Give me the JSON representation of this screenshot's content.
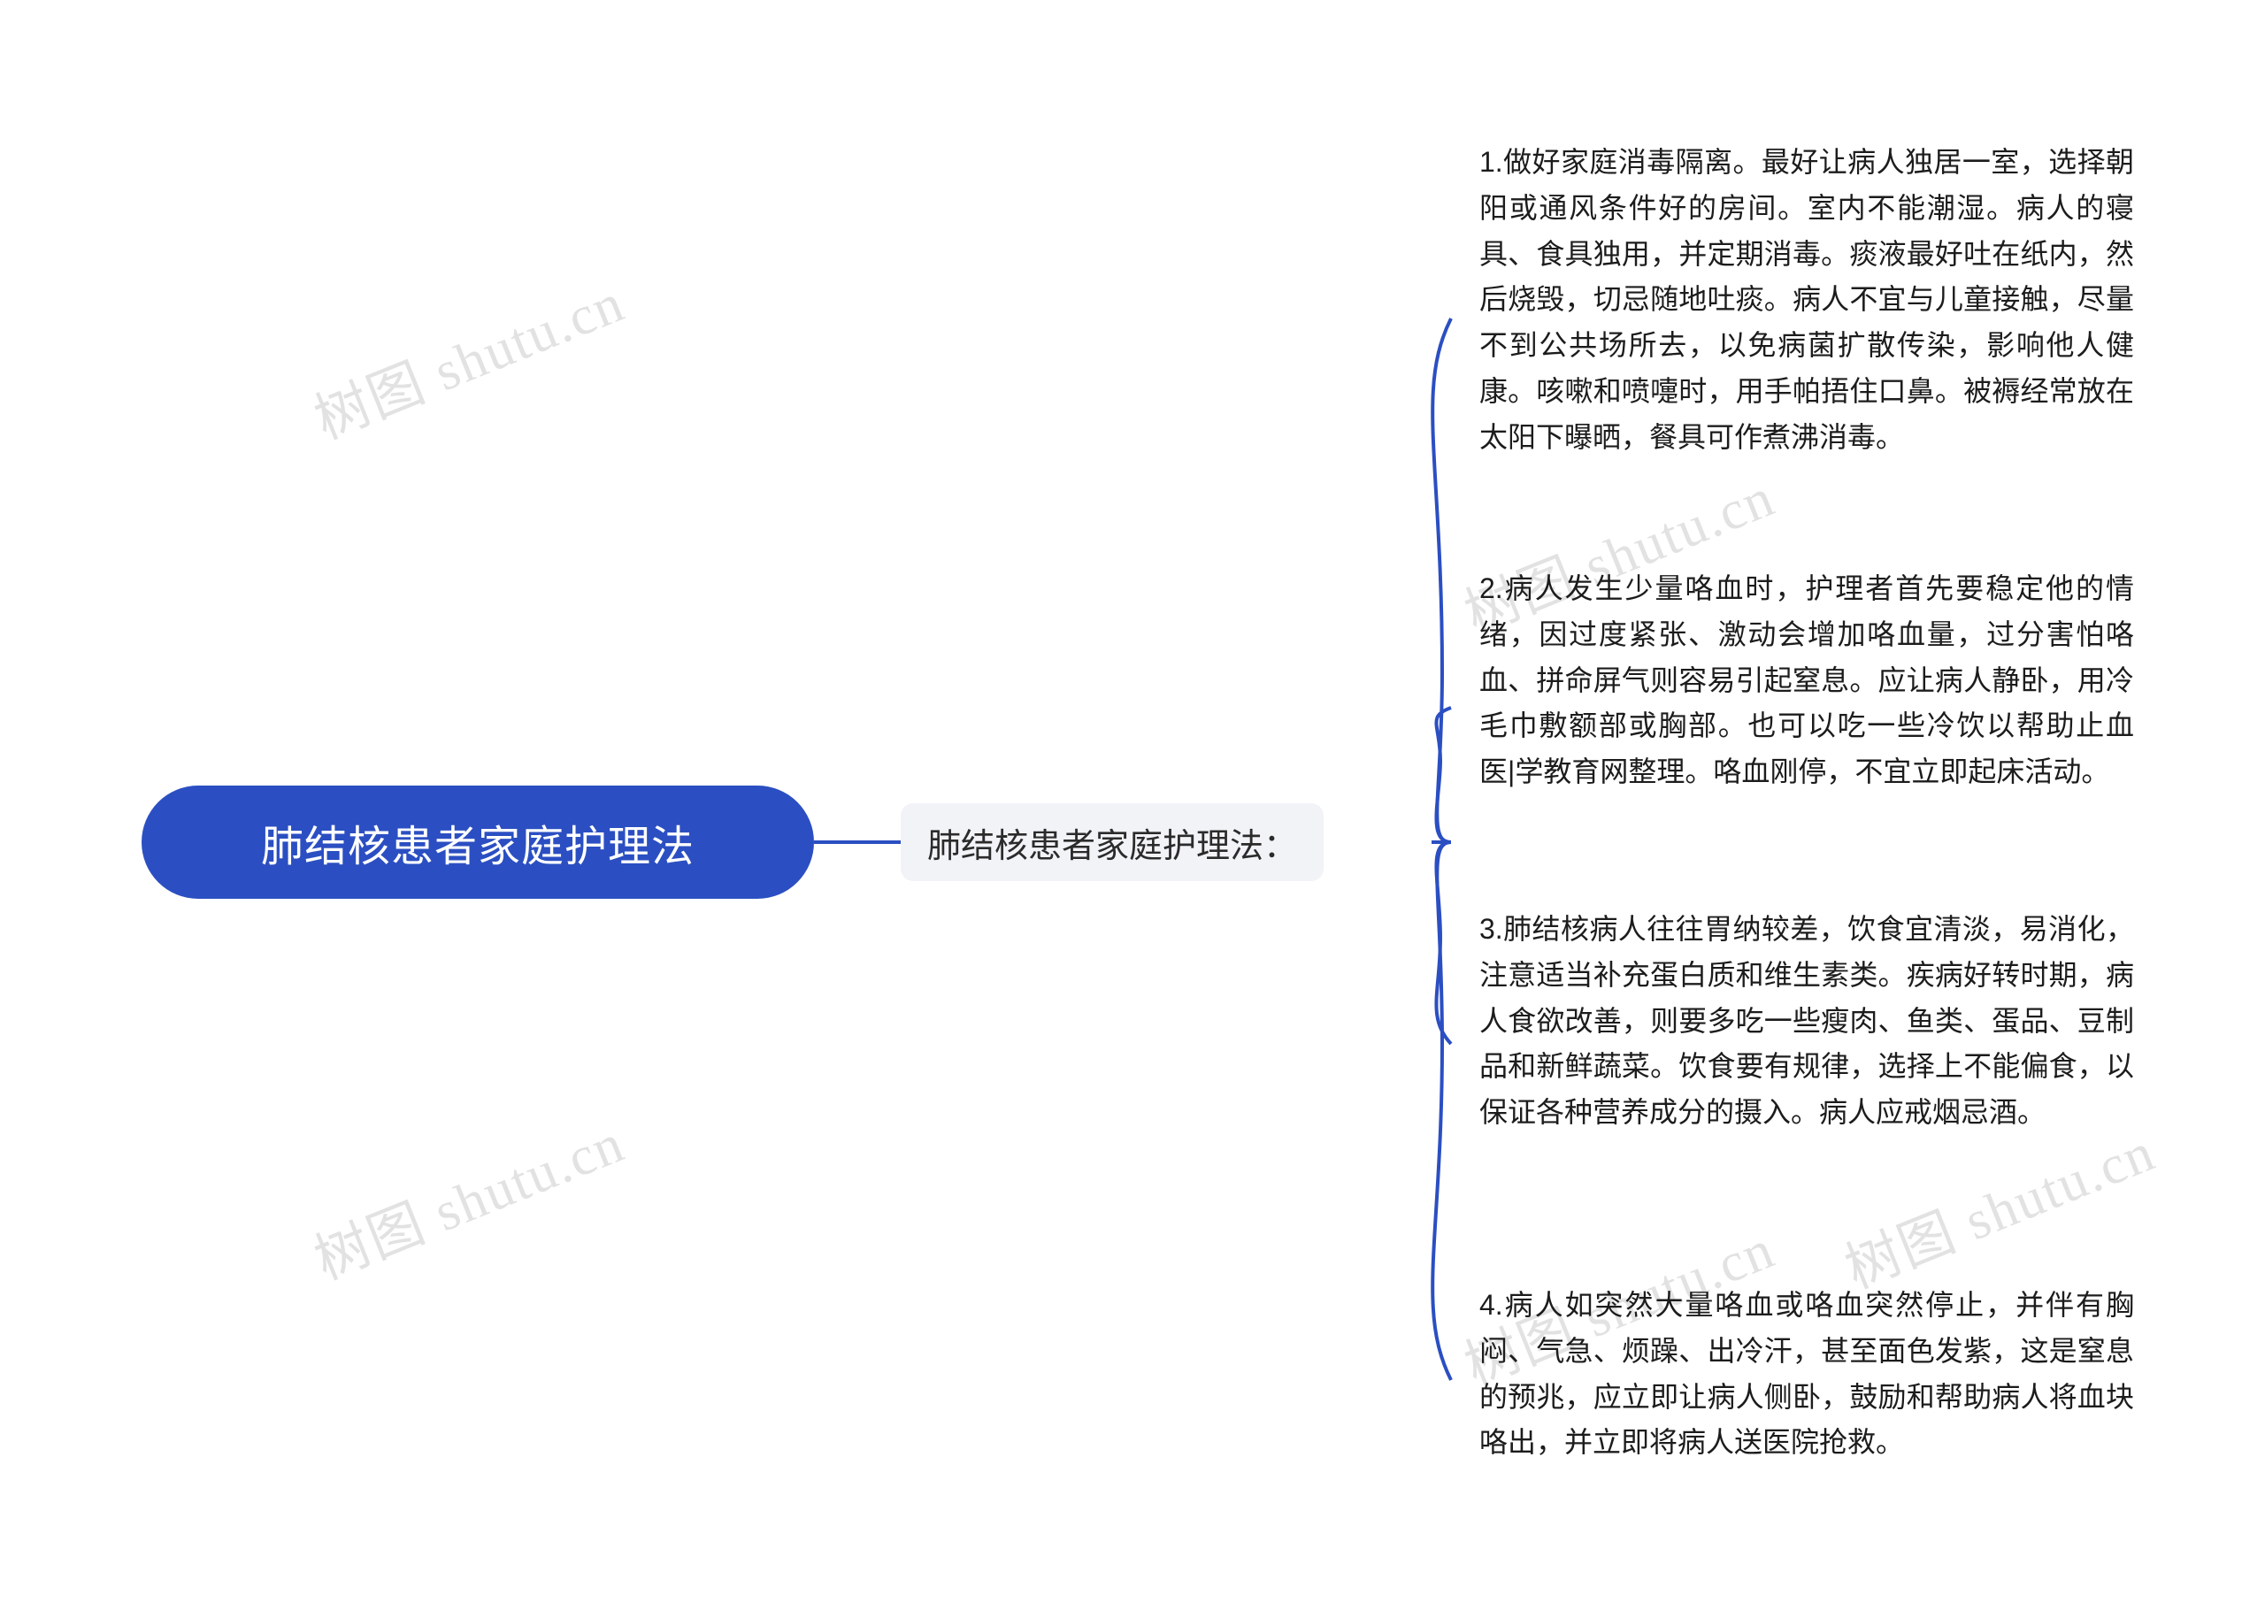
{
  "watermarks": [
    {
      "text": "树图 shutu.cn"
    },
    {
      "text": "树图 shutu.cn"
    },
    {
      "text": "树图 shutu.cn"
    },
    {
      "text": "树图 shutu.cn"
    },
    {
      "text": "树图 shutu.cn"
    }
  ],
  "mindmap": {
    "root": {
      "label": "肺结核患者家庭护理法",
      "color": "#2b4fc2",
      "text_color": "#ffffff"
    },
    "branch": {
      "label": "肺结核患者家庭护理法：",
      "color": "#f1f3f7",
      "text_color": "#2b2b2b"
    },
    "connector_color": "#2b4fc2",
    "leaves": [
      {
        "text": "1.做好家庭消毒隔离。最好让病人独居一室，选择朝阳或通风条件好的房间。室内不能潮湿。病人的寝具、食具独用，并定期消毒。痰液最好吐在纸内，然后烧毁，切忌随地吐痰。病人不宜与儿童接触，尽量不到公共场所去，以免病菌扩散传染，影响他人健康。咳嗽和喷嚏时，用手帕捂住口鼻。被褥经常放在太阳下曝晒，餐具可作煮沸消毒。"
      },
      {
        "text": "2.病人发生少量咯血时，护理者首先要稳定他的情绪，因过度紧张、激动会增加咯血量，过分害怕咯血、拼命屏气则容易引起窒息。应让病人静卧，用冷毛巾敷额部或胸部。也可以吃一些冷饮以帮助止血医|学教育网整理。咯血刚停，不宜立即起床活动。"
      },
      {
        "text": "3.肺结核病人往往胃纳较差，饮食宜清淡，易消化，注意适当补充蛋白质和维生素类。疾病好转时期，病人食欲改善，则要多吃一些瘦肉、鱼类、蛋品、豆制品和新鲜蔬菜。饮食要有规律，选择上不能偏食，以保证各种营养成分的摄入。病人应戒烟忌酒。"
      },
      {
        "text": "4.病人如突然大量咯血或咯血突然停止，并伴有胸闷、气急、烦躁、出冷汗，甚至面色发紫，这是窒息的预兆，应立即让病人侧卧，鼓励和帮助病人将血块咯出，并立即将病人送医院抢救。"
      }
    ]
  }
}
